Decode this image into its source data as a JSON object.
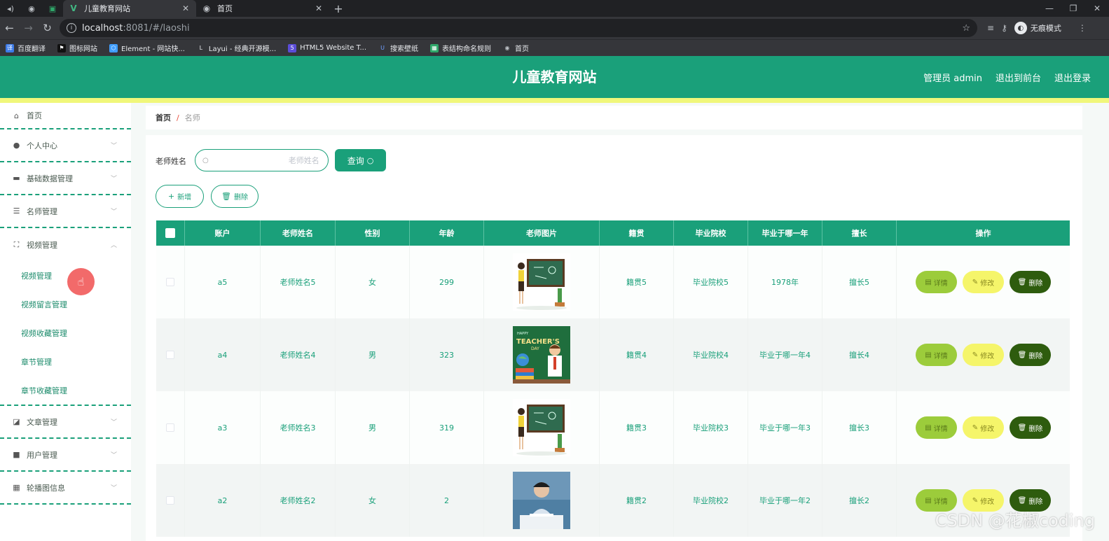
{
  "browser": {
    "tabs": [
      {
        "label": "儿童教育网站",
        "icon": "vue-logo-icon",
        "active": true
      },
      {
        "label": "首页",
        "icon": "globe-icon",
        "active": false
      }
    ],
    "url_host": "localhost",
    "url_rest": ":8081/#/laoshi",
    "incognito_label": "无痕模式",
    "bookmarks": [
      {
        "label": "百度翻译",
        "color": "#3d7be8"
      },
      {
        "label": "图标网站",
        "color": "#111111"
      },
      {
        "label": "Element - 网站快...",
        "color": "#409eff"
      },
      {
        "label": "Layui - 经典开源模...",
        "color": "#888888"
      },
      {
        "label": "HTML5 Website T...",
        "color": "#5b4dd8"
      },
      {
        "label": "搜索壁纸",
        "color": "#3a6ee8"
      },
      {
        "label": "表结构命名规则",
        "color": "#2fa86a"
      },
      {
        "label": "首页",
        "color": "#bdc1c6"
      }
    ]
  },
  "header": {
    "title": "儿童教育网站",
    "admin": "管理员 admin",
    "to_front": "退出到前台",
    "logout": "退出登录",
    "accent": "#1aa07a",
    "stripe": "#f0f77a"
  },
  "sidebar": {
    "items": [
      {
        "label": "首页",
        "icon": "home-icon"
      },
      {
        "label": "个人中心",
        "icon": "user-icon"
      },
      {
        "label": "基础数据管理",
        "icon": "comment-icon"
      },
      {
        "label": "名师管理",
        "icon": "list-icon"
      },
      {
        "label": "视频管理",
        "icon": "fullscreen-icon"
      },
      {
        "label": "文章管理",
        "icon": "chart-icon"
      },
      {
        "label": "用户管理",
        "icon": "camera-icon"
      },
      {
        "label": "轮播图信息",
        "icon": "grid-icon"
      }
    ],
    "sub_items": [
      "视频管理",
      "视频留言管理",
      "视频收藏管理",
      "章节管理",
      "章节收藏管理"
    ]
  },
  "breadcrumb": {
    "home": "首页",
    "sep": "/",
    "current": "名师"
  },
  "search": {
    "label": "老师姓名",
    "placeholder": "老师姓名",
    "button": "查询"
  },
  "actions": {
    "add": "新增",
    "delete": "删除"
  },
  "table": {
    "headers": [
      "账户",
      "老师姓名",
      "性别",
      "年龄",
      "老师图片",
      "籍贯",
      "毕业院校",
      "毕业于哪一年",
      "擅长",
      "操作"
    ],
    "rows": [
      {
        "account": "a5",
        "name": "老师姓名5",
        "gender": "女",
        "age": "299",
        "image": "teacher-blackboard",
        "origin": "籍贯5",
        "school": "毕业院校5",
        "year": "1978年",
        "skill": "擅长5"
      },
      {
        "account": "a4",
        "name": "老师姓名4",
        "gender": "男",
        "age": "323",
        "image": "teachers-day-card",
        "origin": "籍贯4",
        "school": "毕业院校4",
        "year": "毕业于哪一年4",
        "skill": "擅长4"
      },
      {
        "account": "a3",
        "name": "老师姓名3",
        "gender": "男",
        "age": "319",
        "image": "teacher-blackboard",
        "origin": "籍贯3",
        "school": "毕业院校3",
        "year": "毕业于哪一年3",
        "skill": "擅长3"
      },
      {
        "account": "a2",
        "name": "老师姓名2",
        "gender": "女",
        "age": "2",
        "image": "man-studying-photo",
        "origin": "籍贯2",
        "school": "毕业院校2",
        "year": "毕业于哪一年2",
        "skill": "擅长2"
      }
    ],
    "ops": {
      "detail": "详情",
      "edit": "修改",
      "delete": "删除"
    },
    "image_text": {
      "happy": "HAPPY",
      "teachers": "TEACHER'S",
      "day": "DAY"
    }
  },
  "watermark": "CSDN @花椒coding"
}
